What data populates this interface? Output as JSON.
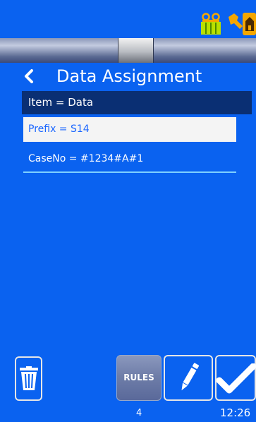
{
  "header": {
    "title": "Data Assignment",
    "icons": [
      "printer-icon",
      "tool-warning-icon",
      "back-icon"
    ]
  },
  "list": {
    "header": "Item = Data",
    "items": [
      {
        "label": "Prefix = S14",
        "selected": true
      },
      {
        "label": "CaseNo = #1234#A#1",
        "selected": false
      }
    ]
  },
  "toolbar": {
    "rules_label": "RULES",
    "icons": [
      "trash-icon",
      "pencil-icon",
      "checkmark-icon"
    ]
  },
  "status": {
    "count": "4",
    "time": "12:26"
  },
  "colors": {
    "background": "#0a62f0",
    "header_row": "#0a2f73",
    "selected_row": "#f4f4f4",
    "selected_text": "#1a66ff",
    "printer_icon": "#b8e000",
    "tool_icon": "#f5a700"
  }
}
